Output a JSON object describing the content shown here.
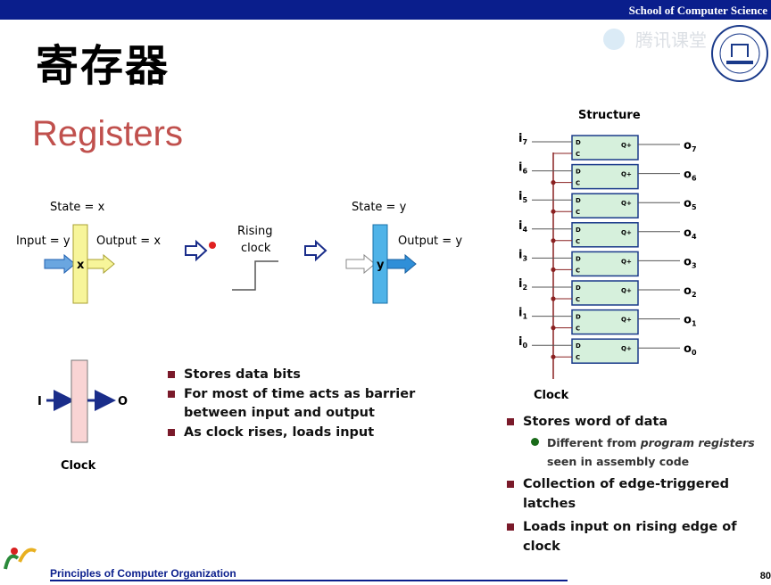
{
  "header": {
    "school": "School of Computer Science",
    "watermark": "腾讯课堂"
  },
  "title": {
    "chinese": "寄存器",
    "english": "Registers"
  },
  "diagram": {
    "state_x": "State = x",
    "input_y": "Input = y",
    "output_x": "Output = x",
    "box_x": "x",
    "rising_clock_1": "Rising",
    "rising_clock_2": "clock",
    "state_y": "State = y",
    "box_y": "y",
    "output_y": "Output = y",
    "reg_in": "I",
    "reg_out": "O",
    "reg_clock": "Clock"
  },
  "bullets_left": [
    "Stores data bits",
    "For most of time acts as barrier",
    "between input and output",
    "As clock rises, loads input"
  ],
  "structure": {
    "title": "Structure",
    "clock_label": "Clock",
    "d": "D",
    "c": "C",
    "q": "Q+",
    "rows": [
      {
        "in": "i",
        "in_sub": "7",
        "out": "o",
        "out_sub": "7"
      },
      {
        "in": "i",
        "in_sub": "6",
        "out": "o",
        "out_sub": "6"
      },
      {
        "in": "i",
        "in_sub": "5",
        "out": "o",
        "out_sub": "5"
      },
      {
        "in": "i",
        "in_sub": "4",
        "out": "o",
        "out_sub": "4"
      },
      {
        "in": "i",
        "in_sub": "3",
        "out": "o",
        "out_sub": "3"
      },
      {
        "in": "i",
        "in_sub": "2",
        "out": "o",
        "out_sub": "2"
      },
      {
        "in": "i",
        "in_sub": "1",
        "out": "o",
        "out_sub": "1"
      },
      {
        "in": "i",
        "in_sub": "0",
        "out": "o",
        "out_sub": "0"
      }
    ]
  },
  "bullets_right": {
    "b1": "Stores word of data",
    "sub1_a": "Different from ",
    "sub1_em": "program registers",
    "sub1_b": "seen in assembly code",
    "b2": "Collection of edge-triggered latches",
    "b3": "Loads input on rising edge of clock"
  },
  "footer": {
    "course": "Principles of Computer Organization",
    "page": "80"
  },
  "colors": {
    "header_blue": "#0a1e8c",
    "title_red": "#c0504d",
    "bullet_maroon": "#7a1a2a",
    "latch_fill": "#d6f0dc",
    "latch_border": "#1a3a8a"
  }
}
